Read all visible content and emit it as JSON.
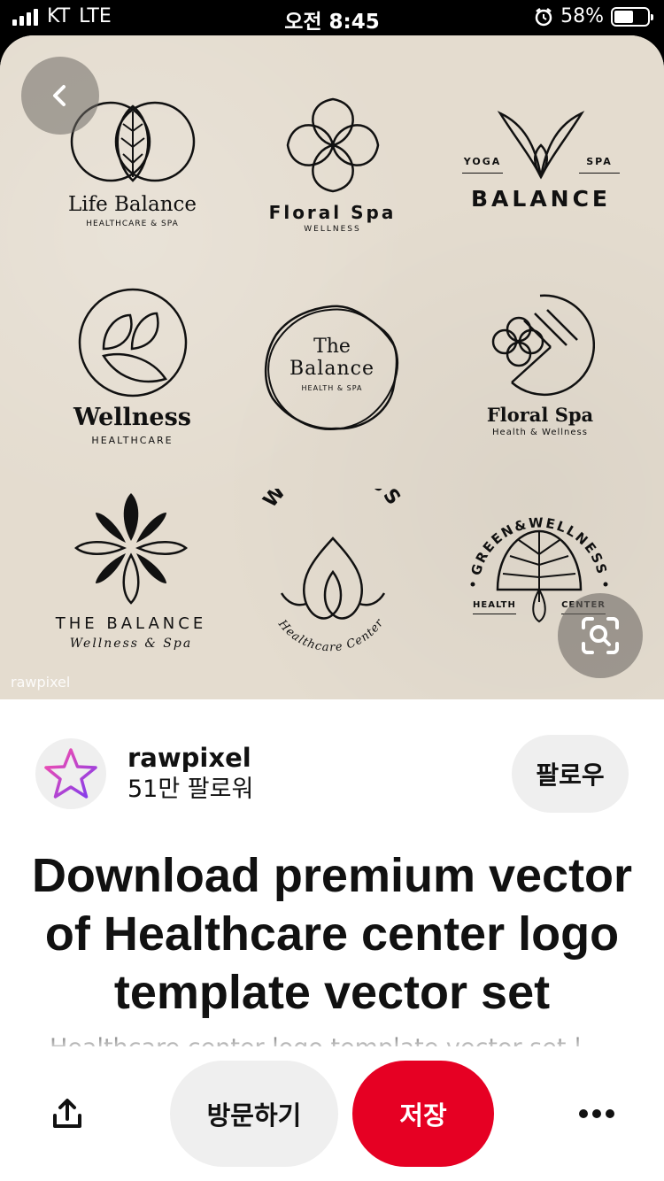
{
  "status": {
    "carrier": "KT",
    "network": "LTE",
    "time": "오전 8:45",
    "battery": "58%",
    "battery_level": 0.58
  },
  "image": {
    "watermark": "rawpixel",
    "logos": [
      {
        "title": "Life Balance",
        "subtitle": "HEALTHCARE & SPA"
      },
      {
        "title": "Floral Spa",
        "subtitle": "WELLNESS"
      },
      {
        "top_left": "YOGA",
        "top_right": "SPA",
        "title": "BALANCE"
      },
      {
        "title": "Wellness",
        "subtitle": "HEALTHCARE"
      },
      {
        "title_line1": "The",
        "title_line2": "Balance",
        "subtitle": "HEALTH & SPA"
      },
      {
        "title": "Floral Spa",
        "subtitle": "Health & Wellness"
      },
      {
        "title": "THE BALANCE",
        "subtitle": "Wellness & Spa"
      },
      {
        "arc_top": "WELLNESS",
        "arc_bottom": "Healthcare Center"
      },
      {
        "arc_top": "GREEN&WELLNESS",
        "left": "HEALTH",
        "right": "CENTER"
      }
    ]
  },
  "profile": {
    "name": "rawpixel",
    "followers": "51만 팔로워",
    "follow_label": "팔로우"
  },
  "pin": {
    "title": "Download premium vector of Healthcare center logo template vector set",
    "description": "Healthcare center logo template vector set |"
  },
  "actions": {
    "visit_label": "방문하기",
    "save_label": "저장"
  },
  "colors": {
    "save": "#e60023",
    "neutral_button": "#efefef"
  }
}
